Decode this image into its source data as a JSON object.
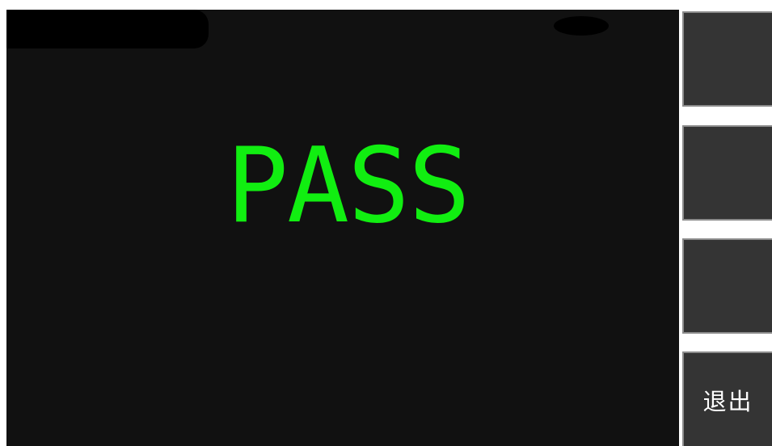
{
  "result": {
    "status_text": "PASS"
  },
  "sidebar": {
    "buttons": [
      {
        "label": ""
      },
      {
        "label": ""
      },
      {
        "label": ""
      },
      {
        "label": "退出"
      }
    ]
  },
  "colors": {
    "pass_text": "#11ee11",
    "panel_background": "#111111",
    "button_background": "#343434"
  }
}
